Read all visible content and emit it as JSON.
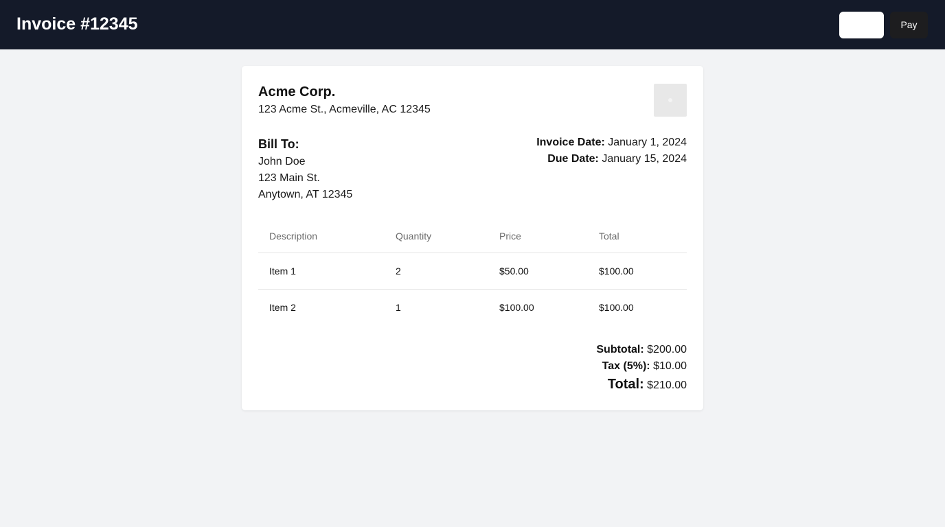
{
  "header": {
    "title": "Invoice #12345",
    "blank_button_label": "",
    "pay_button_label": "Pay"
  },
  "company": {
    "name": "Acme Corp.",
    "address": "123 Acme St., Acmeville, AC 12345"
  },
  "bill_to": {
    "heading": "Bill To:",
    "name": "John Doe",
    "street": "123 Main St.",
    "city_line": "Anytown, AT 12345"
  },
  "meta": {
    "invoice_date_label": "Invoice Date:",
    "invoice_date": "January 1, 2024",
    "due_date_label": "Due Date:",
    "due_date": "January 15, 2024"
  },
  "table": {
    "columns": [
      "Description",
      "Quantity",
      "Price",
      "Total"
    ],
    "rows": [
      [
        "Item 1",
        "2",
        "$50.00",
        "$100.00"
      ],
      [
        "Item 2",
        "1",
        "$100.00",
        "$100.00"
      ]
    ]
  },
  "summary": {
    "subtotal_label": "Subtotal:",
    "subtotal": "$200.00",
    "tax_label": "Tax (5%):",
    "tax": "$10.00",
    "total_label": "Total:",
    "total": "$210.00"
  },
  "colors": {
    "header_bg": "#141a29",
    "page_bg": "#f2f3f5",
    "pay_button_bg": "#1d1d1f"
  },
  "icons": {
    "company_logo": "logo-placeholder"
  }
}
